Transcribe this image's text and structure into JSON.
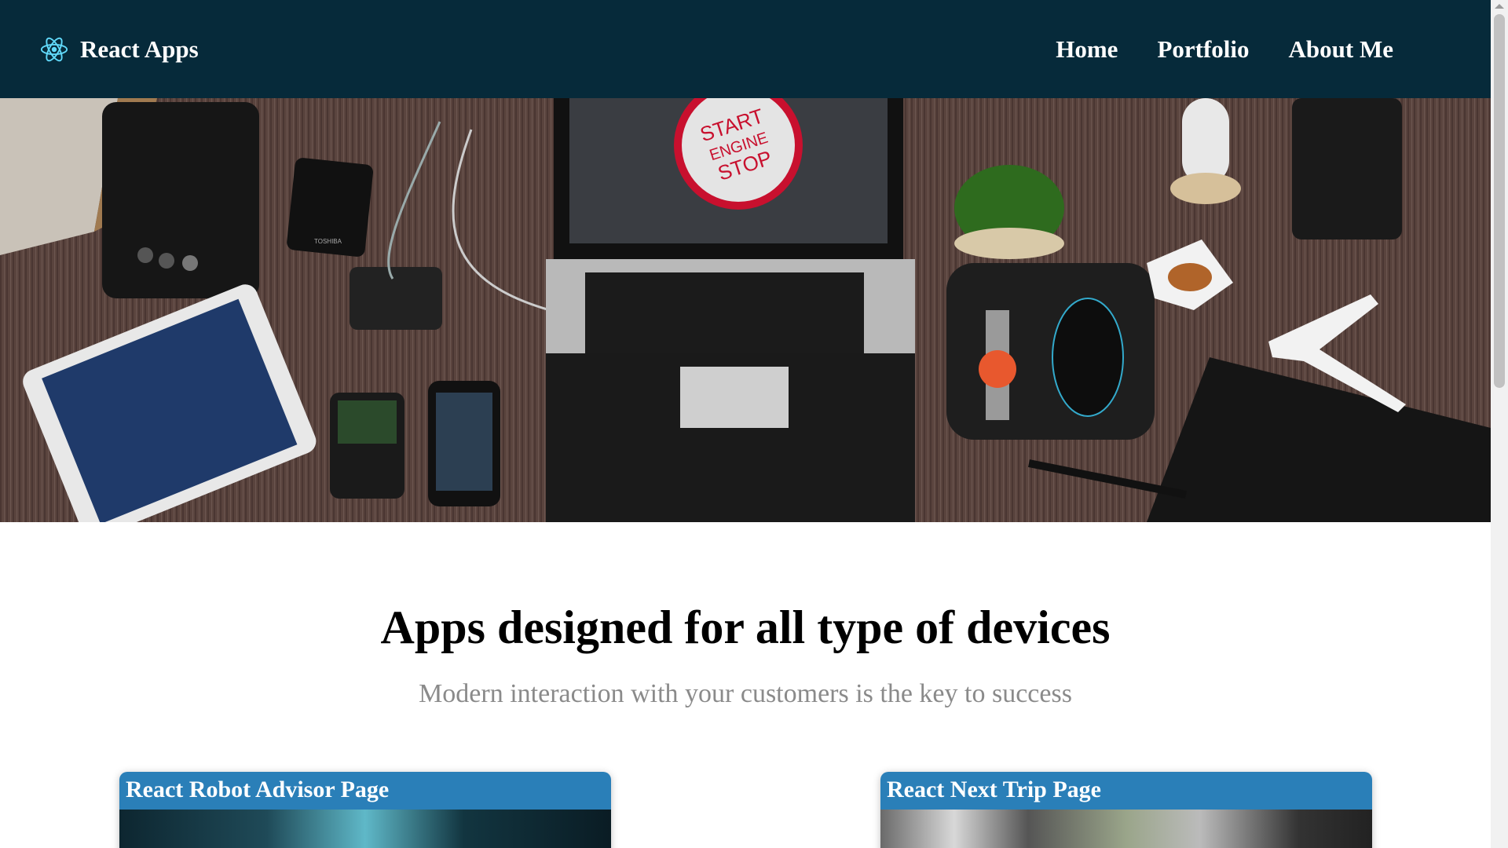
{
  "navbar": {
    "brand": "React Apps",
    "brand_icon": "react-atom-icon",
    "links": [
      "Home",
      "Portfolio",
      "About Me"
    ]
  },
  "hero": {
    "image": "desk-workspace-photo",
    "laptop_screen_text": [
      "START",
      "ENGINE",
      "STOP"
    ],
    "hard_drive_label": "TOSHIBA"
  },
  "main": {
    "headline": "Apps designed for all type of devices",
    "subheadline": "Modern interaction with your customers is the key to success"
  },
  "cards": [
    {
      "title": "React Robot Advisor Page"
    },
    {
      "title": "React Next Trip Page"
    }
  ],
  "colors": {
    "navbar_bg": "#062a3a",
    "card_header": "#2a7fb8",
    "react_blue": "#61dafb"
  }
}
